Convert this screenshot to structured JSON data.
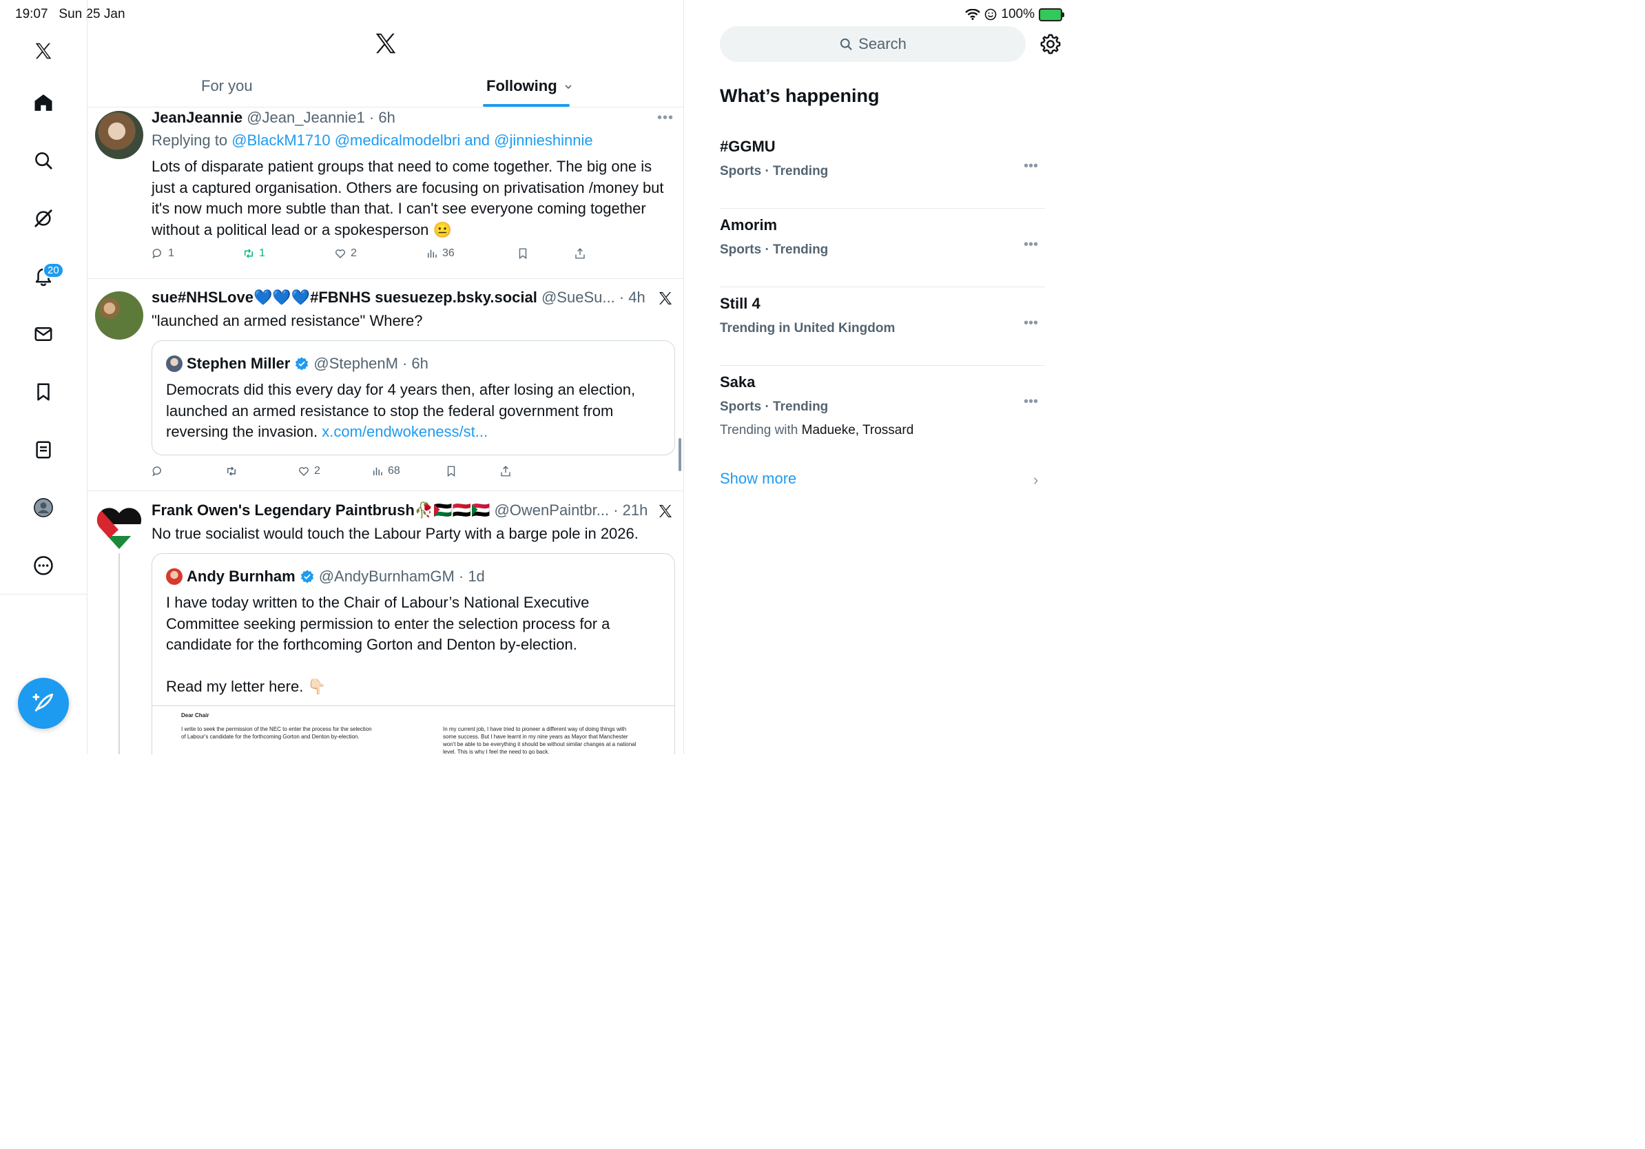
{
  "status_bar": {
    "time": "19:07",
    "date": "Sun 25 Jan",
    "battery": "100%"
  },
  "nav": {
    "items": [
      "x-logo",
      "home",
      "explore",
      "grok",
      "notifications",
      "messages",
      "bookmarks",
      "lists",
      "profile",
      "more"
    ],
    "notifications_badge": "20"
  },
  "tabs": {
    "for_you": "For you",
    "following": "Following"
  },
  "tweets": [
    {
      "name": "JeanJeannie",
      "handle": "@Jean_Jeannie1",
      "time": "· 6h",
      "reply_prefix": "Replying to ",
      "reply_users": "@BlackM1710 @medicalmodelbri",
      "reply_and": " and ",
      "reply_last": "@jinnieshinnie",
      "text": "Lots of disparate patient groups that need to come together. The big one is just a captured organisation. Others are focusing on privatisation /money but it's now much more subtle than that. I can't see everyone coming together without a political lead or a spokesperson 😐",
      "replies": "1",
      "reposts": "1",
      "likes": "2",
      "views": "36"
    },
    {
      "name": "sue#NHSLove💙💙💙#FBNHS suesuezep.bsky.social",
      "handle": "@SueSu...",
      "time": "· 4h",
      "text": "\"launched an armed resistance\" Where?",
      "quote": {
        "name": "Stephen Miller",
        "handle": "@StephenM",
        "time": "· 6h",
        "text": "Democrats did this every day for 4 years then, after losing an election, launched an armed resistance to stop the federal government from reversing the invasion. ",
        "link": "x.com/endwokeness/st..."
      },
      "likes": "2",
      "views": "68"
    },
    {
      "name": "Frank Owen's Legendary Paintbrush🥀🇵🇸🇾🇪🇸🇩",
      "handle": "@OwenPaintbr...",
      "time": "· 21h",
      "text": "No true socialist would touch the Labour Party with a barge pole in 2026.",
      "quote": {
        "name": "Andy Burnham",
        "handle": "@AndyBurnhamGM",
        "time": "· 1d",
        "text1": "I have today written to the Chair of Labour’s National Executive Committee seeking permission to enter the selection process for a candidate for the forthcoming Gorton and Denton by-election.",
        "text2": "Read my letter here. 👇🏻",
        "letter_greeting": "Dear Chair",
        "letter_col1": "I write to seek the permission of the NEC to enter the process for the selection of Labour's candidate for the forthcoming Gorton and Denton by-election.",
        "letter_col2": "In my current job, I have tried to pioneer a different way of doing things with some success. But I have learnt in my nine years as Mayor that Manchester won't be able to be everything it should be without similar changes at a national level. This is why I feel the need to go back."
      }
    }
  ],
  "sidebar": {
    "search_placeholder": "Search",
    "title": "What’s happening",
    "trends": [
      {
        "name": "#GGMU",
        "category": "Sports · Trending"
      },
      {
        "name": "Amorim",
        "category": "Sports · Trending"
      },
      {
        "name": "Still 4",
        "category": "Trending in United Kingdom"
      },
      {
        "name": "Saka",
        "category": "Sports · Trending",
        "with_label": "Trending with ",
        "with_names": "Madueke, Trossard"
      }
    ],
    "show_more": "Show more"
  },
  "colors": {
    "accent": "#1d9bf0",
    "repost_green": "#00ba7c",
    "secondary_text": "#536471",
    "border": "#e5e8eb"
  }
}
